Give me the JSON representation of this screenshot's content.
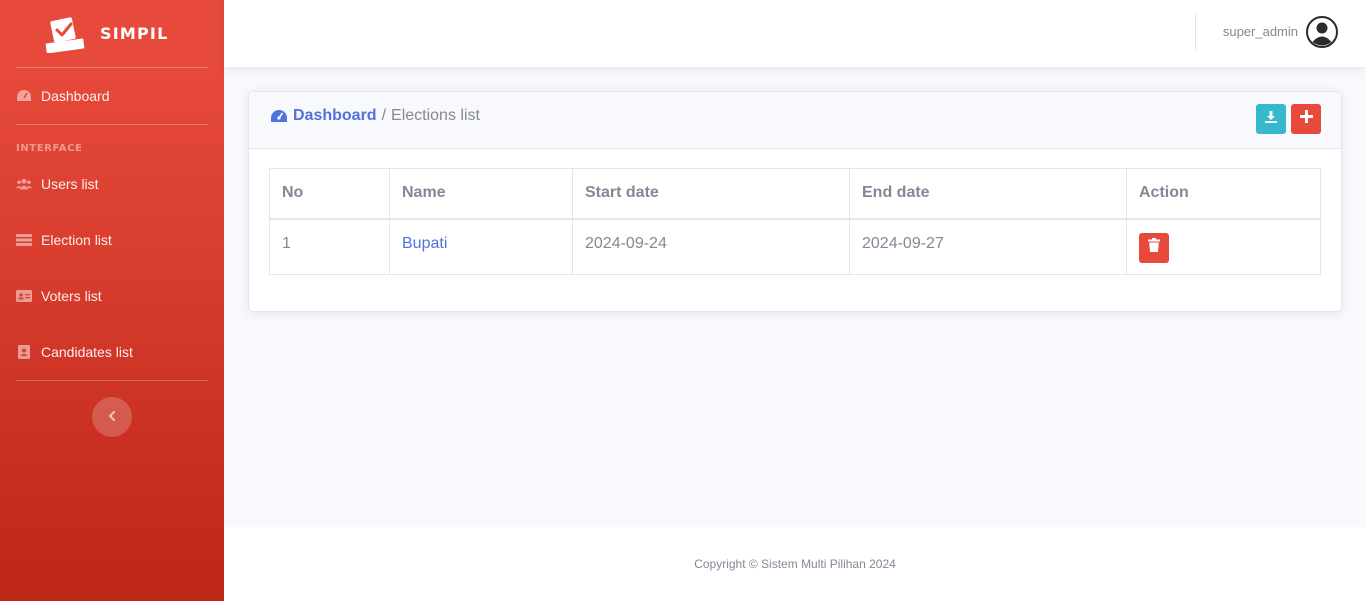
{
  "brand": {
    "name": "SIMPIL"
  },
  "sidebar": {
    "dashboard": "Dashboard",
    "heading": "INTERFACE",
    "items": [
      {
        "label": "Users list",
        "icon": "users-icon"
      },
      {
        "label": "Election list",
        "icon": "list-icon"
      },
      {
        "label": "Voters list",
        "icon": "id-card-icon"
      },
      {
        "label": "Candidates list",
        "icon": "address-book-icon"
      }
    ]
  },
  "topbar": {
    "username": "super_admin"
  },
  "breadcrumb": {
    "home": "Dashboard",
    "separator": "/",
    "current": "Elections list"
  },
  "table": {
    "headers": [
      "No",
      "Name",
      "Start date",
      "End date",
      "Action"
    ],
    "rows": [
      {
        "no": "1",
        "name": "Bupati",
        "start": "2024-09-24",
        "end": "2024-09-27"
      }
    ]
  },
  "footer": {
    "text": "Copyright © Sistem Multi Pilihan 2024"
  },
  "colors": {
    "primary": "#4e73df",
    "danger": "#e74a3b",
    "info": "#36b9cc",
    "muted": "#858796"
  }
}
